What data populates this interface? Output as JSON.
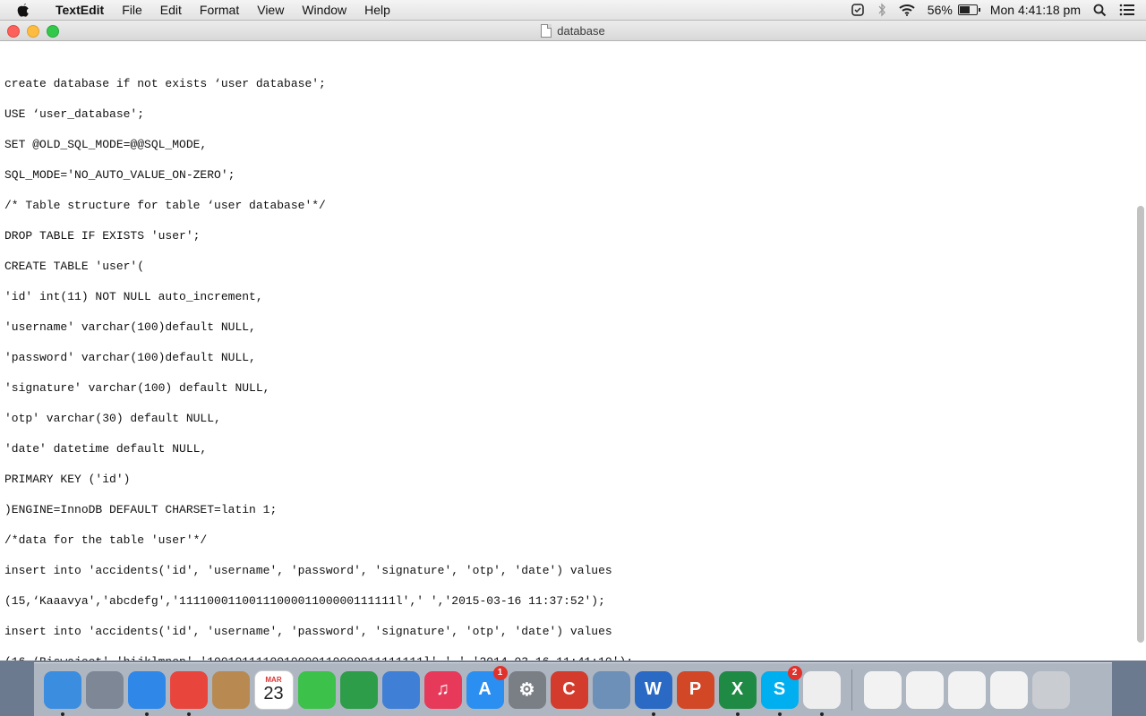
{
  "menubar": {
    "app_name": "TextEdit",
    "items": [
      "File",
      "Edit",
      "Format",
      "View",
      "Window",
      "Help"
    ],
    "battery_percent": "56%",
    "clock": "Mon 4:41:18 pm"
  },
  "window": {
    "title": "database"
  },
  "document": {
    "lines": [
      "create database if not exists ‘user database';",
      "USE ‘user_database';",
      "SET @OLD_SQL_MODE=@@SQL_MODE,",
      "SQL_MODE='NO_AUTO_VALUE_ON-ZERO';",
      "/* Table structure for table ‘user database'*/",
      "DROP TABLE IF EXISTS 'user';",
      "CREATE TABLE 'user'(",
      "'id' int(11) NOT NULL auto_increment,",
      "'username' varchar(100)default NULL,",
      "'password' varchar(100)default NULL,",
      "'signature' varchar(100) default NULL,",
      "'otp' varchar(30) default NULL,",
      "'date' datetime default NULL,",
      "PRIMARY KEY ('id')",
      ")ENGINE=InnoDB DEFAULT CHARSET=latin 1;",
      "/*data for the table 'user'*/",
      "insert into 'accidents('id', 'username', 'password', 'signature', 'otp', 'date') values",
      "(15,‘Kaaavya','abcdefg','1111000110011100001100000111111l',' ','2015-03-16 11:37:52');",
      "insert into 'accidents('id', 'username', 'password', 'signature', 'otp', 'date') values",
      "(16,‘Biswajeet','hijklmnop','1001011110010000110000011111111l',' ','2014-03-16 11:41:10');"
    ]
  },
  "dock": {
    "calendar_month": "MAR",
    "calendar_day": "23",
    "app_store_badge": "1",
    "skype_badge": "2",
    "items": [
      {
        "name": "finder",
        "color": "#3b8de0",
        "glyph": "",
        "running": true
      },
      {
        "name": "launchpad",
        "color": "#7d8796",
        "glyph": "",
        "running": false
      },
      {
        "name": "safari",
        "color": "#2f88e8",
        "glyph": "",
        "running": true
      },
      {
        "name": "chrome",
        "color": "#e8453c",
        "glyph": "",
        "running": true
      },
      {
        "name": "contacts",
        "color": "#b88a52",
        "glyph": "",
        "running": false
      },
      {
        "name": "calendar",
        "color": "#ffffff",
        "glyph": "",
        "running": false
      },
      {
        "name": "facetime",
        "color": "#3cc24b",
        "glyph": "",
        "running": false
      },
      {
        "name": "numbers",
        "color": "#2e9d4a",
        "glyph": "",
        "running": false
      },
      {
        "name": "keynote",
        "color": "#3f7fd6",
        "glyph": "",
        "running": false
      },
      {
        "name": "itunes",
        "color": "#e73a5a",
        "glyph": "♫",
        "running": false
      },
      {
        "name": "app-store",
        "color": "#2a8ff0",
        "glyph": "A",
        "running": false
      },
      {
        "name": "system-preferences",
        "color": "#7a7f86",
        "glyph": "⚙",
        "running": false
      },
      {
        "name": "ccleaner",
        "color": "#d33b2d",
        "glyph": "C",
        "running": false
      },
      {
        "name": "preview",
        "color": "#6c90b8",
        "glyph": "",
        "running": false
      },
      {
        "name": "word",
        "color": "#2a6ac4",
        "glyph": "W",
        "running": true
      },
      {
        "name": "powerpoint",
        "color": "#d24726",
        "glyph": "P",
        "running": false
      },
      {
        "name": "excel",
        "color": "#1f8a44",
        "glyph": "X",
        "running": true
      },
      {
        "name": "skype",
        "color": "#00aff0",
        "glyph": "S",
        "running": true
      },
      {
        "name": "textedit",
        "color": "#eeeeee",
        "glyph": "",
        "running": true
      },
      {
        "name": "documents-stack",
        "color": "#f2f2f2",
        "glyph": "",
        "running": false
      },
      {
        "name": "downloads-stack",
        "color": "#f2f2f2",
        "glyph": "",
        "running": false
      },
      {
        "name": "screenshot-stack",
        "color": "#f2f2f2",
        "glyph": "",
        "running": false
      },
      {
        "name": "window-preview",
        "color": "#f2f2f2",
        "glyph": "",
        "running": false
      },
      {
        "name": "trash",
        "color": "#c9ccd0",
        "glyph": "",
        "running": false
      }
    ]
  }
}
